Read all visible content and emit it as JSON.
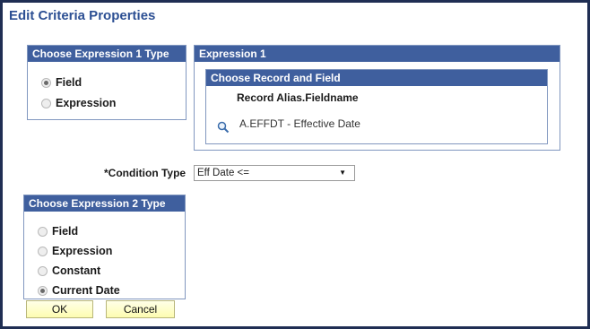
{
  "title": "Edit Criteria Properties",
  "expr1_type": {
    "header": "Choose Expression 1 Type",
    "options": [
      {
        "label": "Field",
        "selected": true
      },
      {
        "label": "Expression",
        "selected": false
      }
    ]
  },
  "expression1": {
    "header": "Expression 1",
    "record_group": {
      "header": "Choose Record and Field",
      "column_label": "Record Alias.Fieldname",
      "value": "A.EFFDT - Effective Date",
      "lookup_icon": "magnifier-icon"
    }
  },
  "condition": {
    "label": "*Condition Type",
    "selected": "Eff Date <="
  },
  "expr2_type": {
    "header": "Choose Expression 2 Type",
    "options": [
      {
        "label": "Field",
        "selected": false
      },
      {
        "label": "Expression",
        "selected": false
      },
      {
        "label": "Constant",
        "selected": false
      },
      {
        "label": "Current Date",
        "selected": true
      }
    ]
  },
  "buttons": {
    "ok": "OK",
    "cancel": "Cancel"
  },
  "colors": {
    "header_bg": "#3f5f9e",
    "title": "#2c4f93",
    "button_bg": "#fdfcb0"
  }
}
